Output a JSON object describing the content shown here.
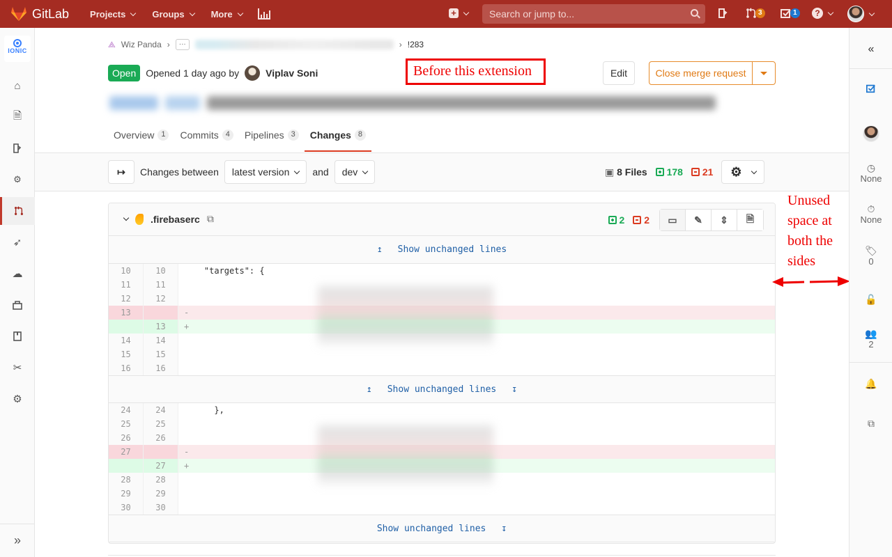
{
  "topbar": {
    "brand": "GitLab",
    "nav": [
      {
        "label": "Projects"
      },
      {
        "label": "Groups"
      },
      {
        "label": "More"
      }
    ],
    "search_placeholder": "Search or jump to...",
    "merge_requests_count": "3",
    "todos_count": "1",
    "colors": {
      "bg": "#a52c22",
      "mr_badge": "#e07a14",
      "todo_badge": "#1f78d1"
    }
  },
  "left_sidebar": {
    "project_avatar_text": "IONIC",
    "items": [
      {
        "icon": "home-icon"
      },
      {
        "icon": "repository-icon"
      },
      {
        "icon": "issues-icon"
      },
      {
        "icon": "ci-cd-icon"
      },
      {
        "icon": "merge-request-icon",
        "active": true
      },
      {
        "icon": "deploy-icon"
      },
      {
        "icon": "operations-icon"
      },
      {
        "icon": "packages-icon"
      },
      {
        "icon": "wiki-icon"
      },
      {
        "icon": "snippets-icon"
      },
      {
        "icon": "settings-icon"
      }
    ],
    "collapse_label": "»"
  },
  "breadcrumb": {
    "group": "Wiz Panda",
    "ellipsis": "···",
    "current": "!283"
  },
  "mr": {
    "status": "Open",
    "opened_text": "Opened 1 day ago by",
    "author": "Viplav Soni",
    "edit_label": "Edit",
    "close_label": "Close merge request"
  },
  "annotation": {
    "before_label": "Before this extension",
    "unused_label": "Unused space at both the sides"
  },
  "tabs": [
    {
      "label": "Overview",
      "count": "1"
    },
    {
      "label": "Commits",
      "count": "4"
    },
    {
      "label": "Pipelines",
      "count": "3"
    },
    {
      "label": "Changes",
      "count": "8",
      "active": true
    }
  ],
  "changes_bar": {
    "changes_between": "Changes between",
    "version_select": "latest version",
    "and": "and",
    "target_select": "dev",
    "files": "8 Files",
    "additions": "178",
    "deletions": "21"
  },
  "file": {
    "name": ".firebaserc",
    "additions": "2",
    "deletions": "2",
    "show_unchanged": "Show unchanged lines",
    "hunks": [
      {
        "lines": [
          {
            "old": "10",
            "new": "10",
            "type": "ctx",
            "code": "    \"targets\": {"
          },
          {
            "old": "11",
            "new": "11",
            "type": "ctx",
            "code": ""
          },
          {
            "old": "12",
            "new": "12",
            "type": "ctx",
            "code": ""
          },
          {
            "old": "13",
            "new": "",
            "type": "old",
            "code": "-"
          },
          {
            "old": "",
            "new": "13",
            "type": "new",
            "code": "+"
          },
          {
            "old": "14",
            "new": "14",
            "type": "ctx",
            "code": ""
          },
          {
            "old": "15",
            "new": "15",
            "type": "ctx",
            "code": ""
          },
          {
            "old": "16",
            "new": "16",
            "type": "ctx",
            "code": ""
          }
        ]
      },
      {
        "lines": [
          {
            "old": "24",
            "new": "24",
            "type": "ctx",
            "code": "      },"
          },
          {
            "old": "25",
            "new": "25",
            "type": "ctx",
            "code": ""
          },
          {
            "old": "26",
            "new": "26",
            "type": "ctx",
            "code": ""
          },
          {
            "old": "27",
            "new": "",
            "type": "old",
            "code": "-"
          },
          {
            "old": "",
            "new": "27",
            "type": "new",
            "code": "+"
          },
          {
            "old": "28",
            "new": "28",
            "type": "ctx",
            "code": ""
          },
          {
            "old": "29",
            "new": "29",
            "type": "ctx",
            "code": ""
          },
          {
            "old": "30",
            "new": "30",
            "type": "ctx",
            "code": ""
          }
        ]
      }
    ]
  },
  "right_sidebar": {
    "collapse_label": "«",
    "milestone": "None",
    "time_tracking": "None",
    "labels_count": "0",
    "participants_count": "2"
  }
}
